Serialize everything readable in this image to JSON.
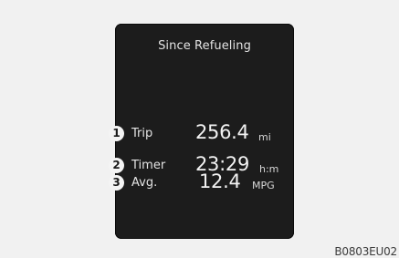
{
  "panel": {
    "title": "Since Refueling",
    "rows": [
      {
        "badge": "1",
        "label": "Trip",
        "value": "256.4",
        "unit": "mi"
      },
      {
        "badge": "2",
        "label": "Timer",
        "value": "23:29",
        "unit": "h:m"
      },
      {
        "badge": "3",
        "label": "Avg.",
        "value": "12.4",
        "unit": "MPG"
      }
    ]
  },
  "image_code": "B0803EU02",
  "colors": {
    "page_background": "#f1f1f1",
    "panel_background": "#1c1c1c",
    "panel_text": "#f2f2f2",
    "badge_background": "#f4f4f4"
  }
}
